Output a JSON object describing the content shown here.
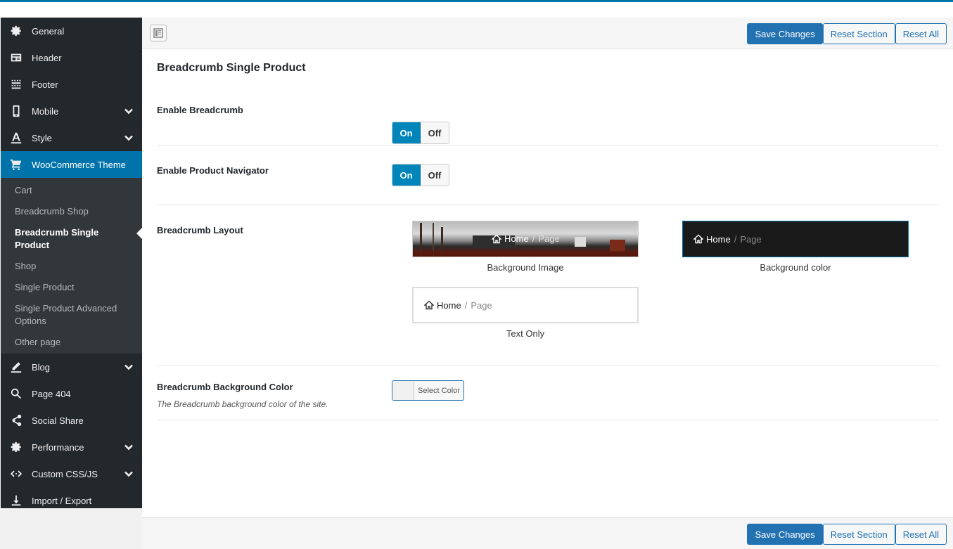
{
  "sidebar": {
    "items": [
      {
        "label": "General",
        "icon": "gear-icon"
      },
      {
        "label": "Header",
        "icon": "header-icon"
      },
      {
        "label": "Footer",
        "icon": "footer-icon"
      },
      {
        "label": "Mobile",
        "icon": "mobile-icon"
      },
      {
        "label": "Style",
        "icon": "style-icon"
      },
      {
        "label": "WooCommerce Theme",
        "icon": "cart-icon"
      },
      {
        "label": "Blog",
        "icon": "pen-icon"
      },
      {
        "label": "Page 404",
        "icon": "search-icon"
      },
      {
        "label": "Social Share",
        "icon": "share-icon"
      },
      {
        "label": "Performance",
        "icon": "gear-icon"
      },
      {
        "label": "Custom CSS/JS",
        "icon": "code-icon"
      },
      {
        "label": "Import / Export",
        "icon": "download-icon"
      }
    ],
    "submenu": [
      "Cart",
      "Breadcrumb Shop",
      "Breadcrumb Single Product",
      "Shop",
      "Single Product",
      "Single Product Advanced Options",
      "Other page"
    ]
  },
  "toolbar": {
    "save_label": "Save Changes",
    "reset_section_label": "Reset Section",
    "reset_all_label": "Reset All"
  },
  "main": {
    "section_title": "Breadcrumb Single Product",
    "enable_breadcrumb": {
      "label": "Enable Breadcrumb",
      "on": "On",
      "off": "Off",
      "value": "On"
    },
    "enable_navigator": {
      "label": "Enable Product Navigator",
      "on": "On",
      "off": "Off",
      "value": "On"
    },
    "layout": {
      "label": "Breadcrumb Layout",
      "home": "Home",
      "sep": "/",
      "page": "Page",
      "options": [
        "Background Image",
        "Background color",
        "Text Only"
      ],
      "selected": "Background color"
    },
    "bg_color": {
      "label": "Breadcrumb Background Color",
      "description": "The Breadcrumb background color of the site.",
      "button": "Select Color"
    }
  },
  "colors": {
    "accent": "#0073aa",
    "sidebar_bg": "#23282d",
    "switch_on": "#0085ba",
    "button_blue": "#2271b1"
  }
}
